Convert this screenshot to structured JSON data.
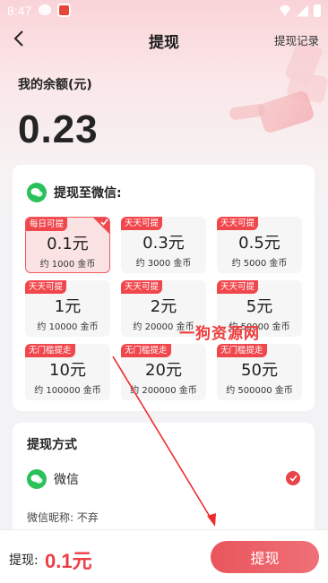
{
  "status_bar": {
    "time": "8:47"
  },
  "header": {
    "title": "提现",
    "record_link": "提现记录"
  },
  "balance": {
    "label": "我的余额(元)",
    "value": "0.23"
  },
  "wechat_card": {
    "title": "提现至微信:",
    "options": [
      {
        "tag": "每日可提",
        "amount": "0.1元",
        "coins": "约 1000 金币",
        "selected": true
      },
      {
        "tag": "天天可提",
        "amount": "0.3元",
        "coins": "约 3000 金币",
        "selected": false
      },
      {
        "tag": "天天可提",
        "amount": "0.5元",
        "coins": "约 5000 金币",
        "selected": false
      },
      {
        "tag": "天天可提",
        "amount": "1元",
        "coins": "约 10000 金币",
        "selected": false
      },
      {
        "tag": "天天可提",
        "amount": "2元",
        "coins": "约 20000 金币",
        "selected": false
      },
      {
        "tag": "天天可提",
        "amount": "5元",
        "coins": "约 50000 金币",
        "selected": false
      },
      {
        "tag": "无门槛提走",
        "amount": "10元",
        "coins": "约 100000 金币",
        "selected": false
      },
      {
        "tag": "无门槛提走",
        "amount": "20元",
        "coins": "约 200000 金币",
        "selected": false
      },
      {
        "tag": "无门槛提走",
        "amount": "50元",
        "coins": "约 500000 金币",
        "selected": false
      }
    ]
  },
  "method_card": {
    "title": "提现方式",
    "method": "微信",
    "nickname": "微信昵称:  不弃"
  },
  "watermark": "一狗资源网",
  "bottom_bar": {
    "label": "提现:",
    "amount": "0.1元",
    "submit": "提现"
  },
  "colors": {
    "accent": "#f0474c",
    "wechat_green": "#2ac15a",
    "button": "#ec5e65"
  }
}
